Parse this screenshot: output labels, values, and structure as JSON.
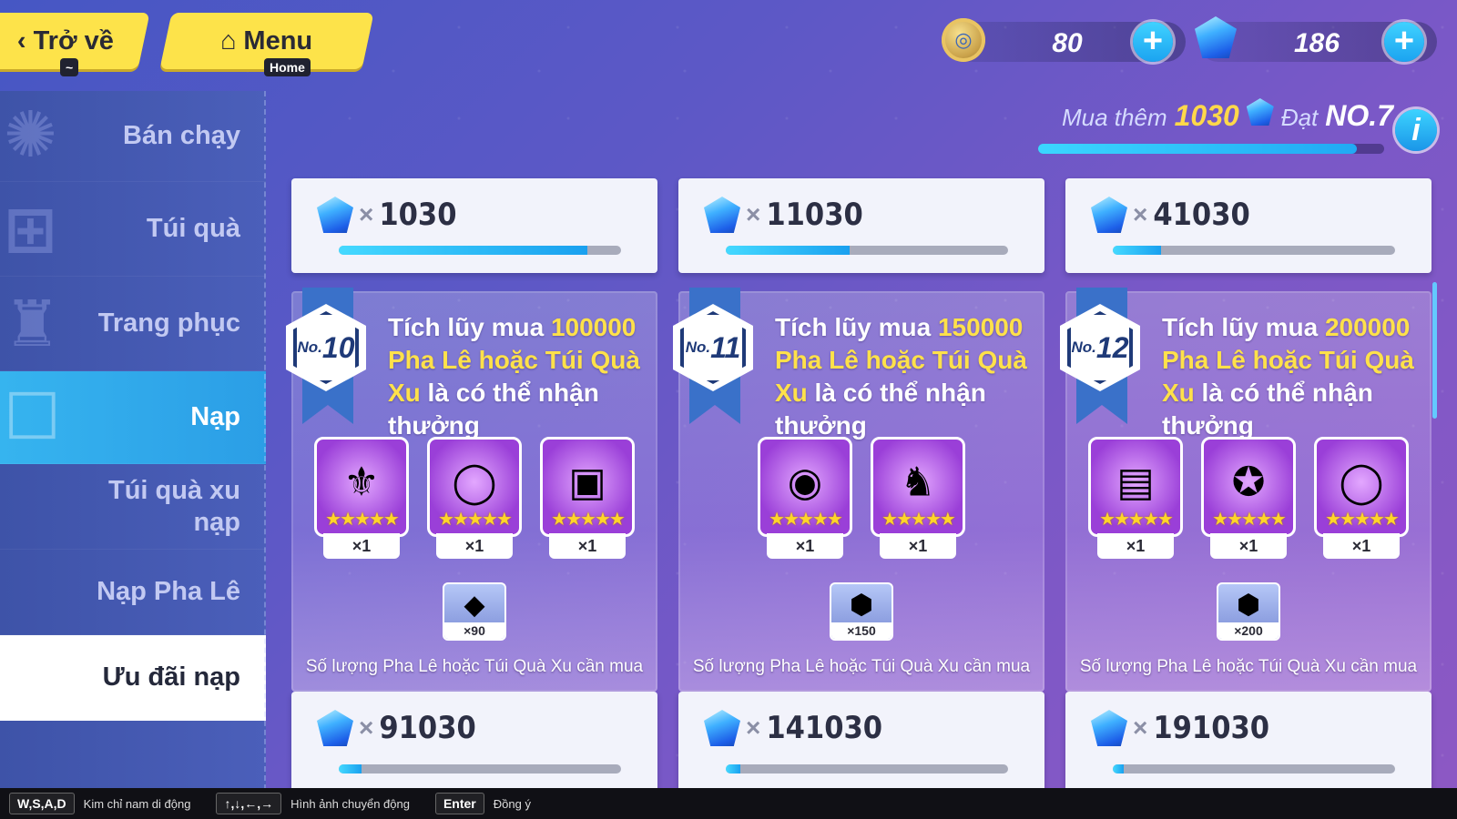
{
  "top": {
    "back_label": "Trở về",
    "back_key": "~",
    "menu_label": "Menu",
    "menu_key": "Home",
    "coins": "80",
    "gems": "186",
    "buy_more_label": "Mua thêm",
    "buy_more_amount": "1030",
    "reach_label": "Đạt",
    "reach_rank": "NO.7",
    "progress": 0.92,
    "info_label": "i"
  },
  "sidebar": {
    "items": [
      {
        "label": "Bán chạy"
      },
      {
        "label": "Túi quà"
      },
      {
        "label": "Trang phục"
      },
      {
        "label": "Nạp"
      },
      {
        "label": "Túi quà xu nạp"
      },
      {
        "label": "Nạp Pha Lê"
      },
      {
        "label": "Ưu đãi nạp"
      }
    ]
  },
  "tiers": [
    {
      "top_amount": "1030",
      "top_progress": 0.88,
      "no_small": "No.",
      "no_big": "10",
      "desc_a": "Tích lũy mua ",
      "desc_num": "100000",
      "desc_b": " Pha Lê hoặc Túi Quà Xu",
      "desc_c": " là có thể nhận thưởng",
      "rewards": [
        "×1",
        "×1",
        "×1"
      ],
      "extra_qty": "×90",
      "need_label": "Số lượng Pha Lê hoặc Túi Quà Xu cần mua",
      "bottom_amount": "91030",
      "bottom_progress": 0.08
    },
    {
      "top_amount": "11030",
      "top_progress": 0.44,
      "no_small": "No.",
      "no_big": "11",
      "desc_a": "Tích lũy mua ",
      "desc_num": "150000",
      "desc_b": " Pha Lê hoặc Túi Quà Xu",
      "desc_c": " là có thể nhận thưởng",
      "rewards": [
        "×1",
        "×1"
      ],
      "extra_qty": "×150",
      "need_label": "Số lượng Pha Lê hoặc Túi Quà Xu cần mua",
      "bottom_amount": "141030",
      "bottom_progress": 0.05
    },
    {
      "top_amount": "41030",
      "top_progress": 0.17,
      "no_small": "No.",
      "no_big": "12",
      "desc_a": "Tích lũy mua ",
      "desc_num": "200000",
      "desc_b": " Pha Lê hoặc Túi Quà Xu",
      "desc_c": " là có thể nhận thưởng",
      "rewards": [
        "×1",
        "×1",
        "×1"
      ],
      "extra_qty": "×200",
      "need_label": "Số lượng Pha Lê hoặc Túi Quà Xu cần mua",
      "bottom_amount": "191030",
      "bottom_progress": 0.04
    }
  ],
  "x_sign": "×",
  "hints": [
    {
      "key": "W,S,A,D",
      "text": "Kim chỉ nam di động"
    },
    {
      "key": "↑,↓,←,→",
      "text": "Hình ảnh chuyển động"
    },
    {
      "key": "Enter",
      "text": "Đồng ý"
    }
  ]
}
